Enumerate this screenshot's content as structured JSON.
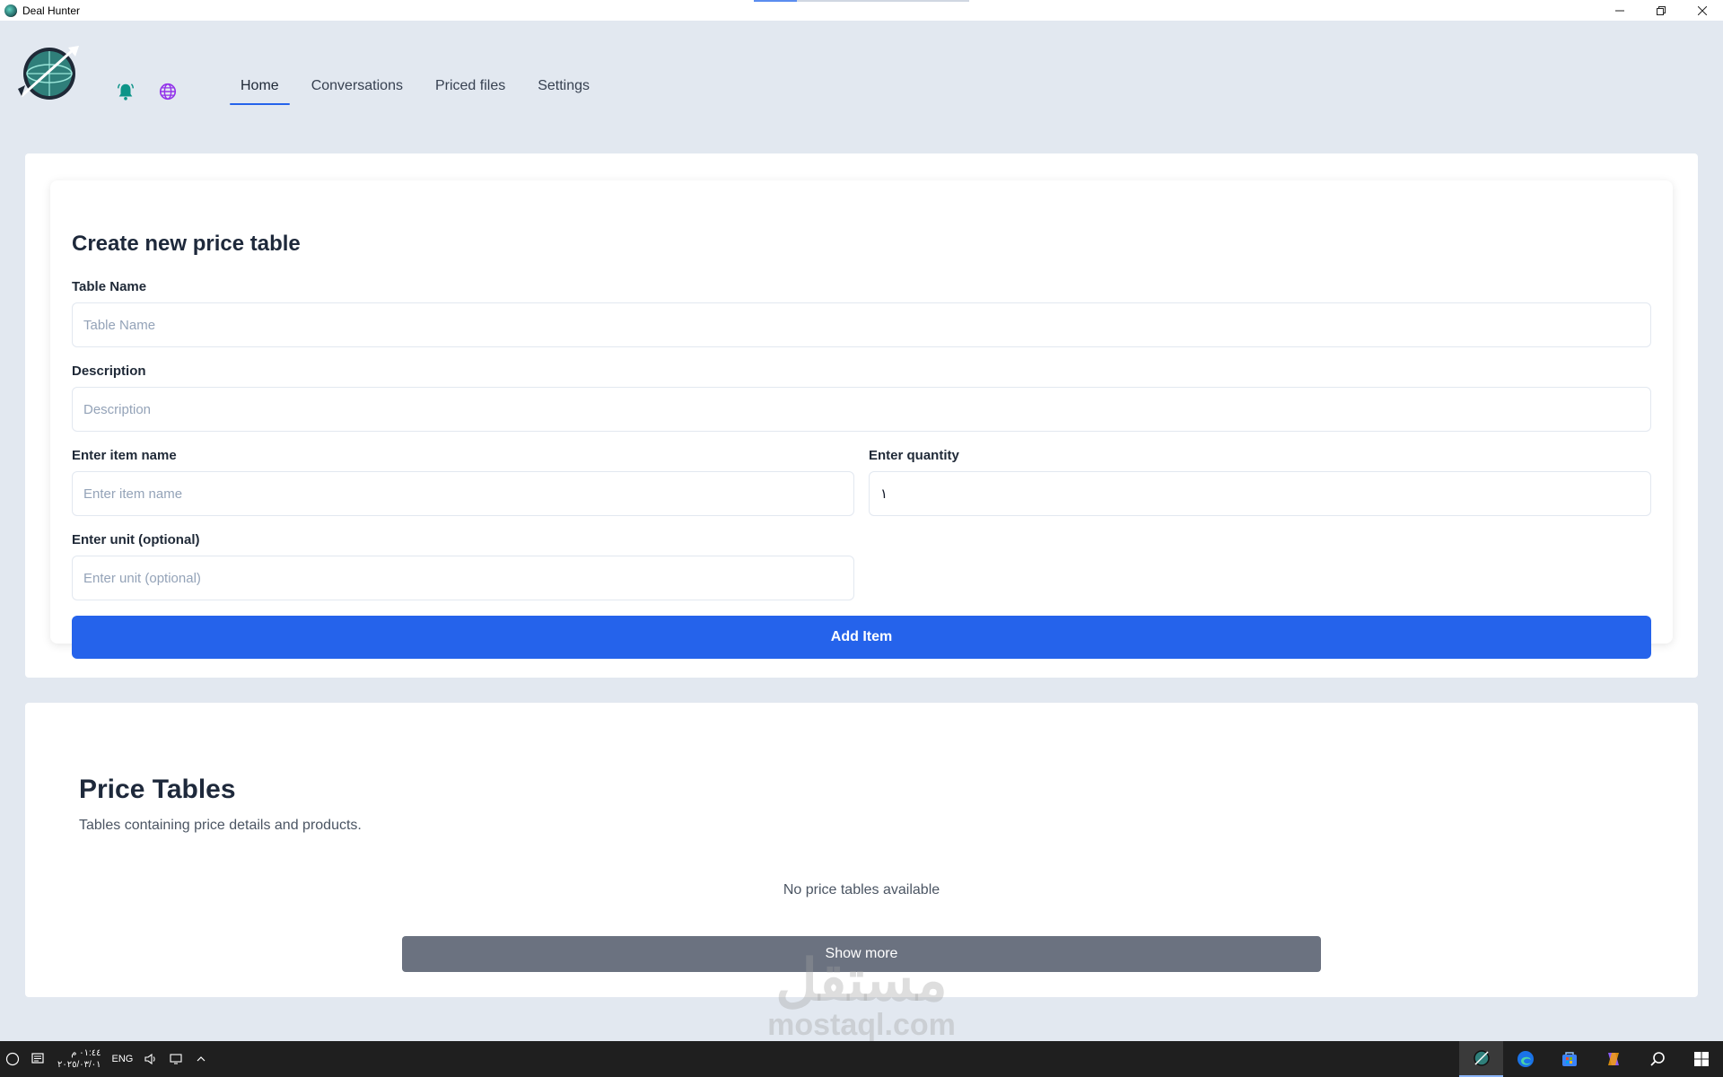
{
  "window": {
    "title": "Deal Hunter",
    "controls": {
      "minimize": "—",
      "restore": "❐",
      "close": "✕"
    }
  },
  "nav": {
    "items": [
      {
        "label": "Home"
      },
      {
        "label": "Conversations"
      },
      {
        "label": "Priced files"
      },
      {
        "label": "Settings"
      }
    ],
    "active_index": 0,
    "icons": [
      "bell-icon",
      "globe-icon"
    ],
    "colors": {
      "bell": "#0d9488",
      "globe": "#9333ea",
      "active_underline": "#2563eb"
    }
  },
  "create_form": {
    "title": "Create new price table",
    "table_name": {
      "label": "Table Name",
      "placeholder": "Table Name",
      "value": ""
    },
    "description": {
      "label": "Description",
      "placeholder": "Description",
      "value": ""
    },
    "item_name": {
      "label": "Enter item name",
      "placeholder": "Enter item name",
      "value": ""
    },
    "quantity": {
      "label": "Enter quantity",
      "value": "١"
    },
    "unit": {
      "label": "Enter unit (optional)",
      "placeholder": "Enter unit (optional)",
      "value": ""
    },
    "add_button": "Add Item",
    "button_color": "#2563eb"
  },
  "price_tables": {
    "title": "Price Tables",
    "subtitle": "Tables containing price details and products.",
    "empty_message": "No price tables available",
    "show_more": "Show more"
  },
  "watermark": {
    "line1": "مستقل",
    "line2": "mostaql.com"
  },
  "taskbar": {
    "time": "٠١:٤٤ م",
    "date": "٢٠٢٥/٠٣/٠١",
    "language": "ENG",
    "apps": [
      "deal-hunter-icon",
      "edge-icon",
      "store-icon",
      "copilot-icon",
      "search-icon",
      "windows-icon"
    ]
  }
}
